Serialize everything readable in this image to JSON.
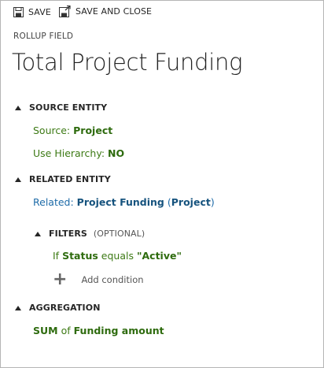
{
  "toolbar": {
    "save_label": "SAVE",
    "save_close_label": "SAVE AND CLOSE",
    "save_icon": "save-icon",
    "save_close_icon": "save-and-close-icon"
  },
  "header": {
    "field_type": "ROLLUP FIELD",
    "title": "Total Project Funding"
  },
  "source_entity": {
    "heading": "SOURCE ENTITY",
    "source_label": "Source:",
    "source_value": "Project",
    "hierarchy_label": "Use Hierarchy:",
    "hierarchy_value": "NO"
  },
  "related_entity": {
    "heading": "RELATED ENTITY",
    "related_label": "Related:",
    "related_value": "Project Funding",
    "related_paren_open": "(",
    "related_parent": "Project",
    "related_paren_close": ")"
  },
  "filters": {
    "heading": "FILTERS",
    "optional": "(OPTIONAL)",
    "cond_if": "If",
    "cond_field": "Status",
    "cond_operator": "equals",
    "cond_value": "\"Active\"",
    "add_condition": "Add condition",
    "add_icon": "plus-icon"
  },
  "aggregation": {
    "heading": "AGGREGATION",
    "function": "SUM",
    "of": "of",
    "field": "Funding amount"
  },
  "colors": {
    "green": "#3d7a15",
    "blue": "#16537e"
  }
}
